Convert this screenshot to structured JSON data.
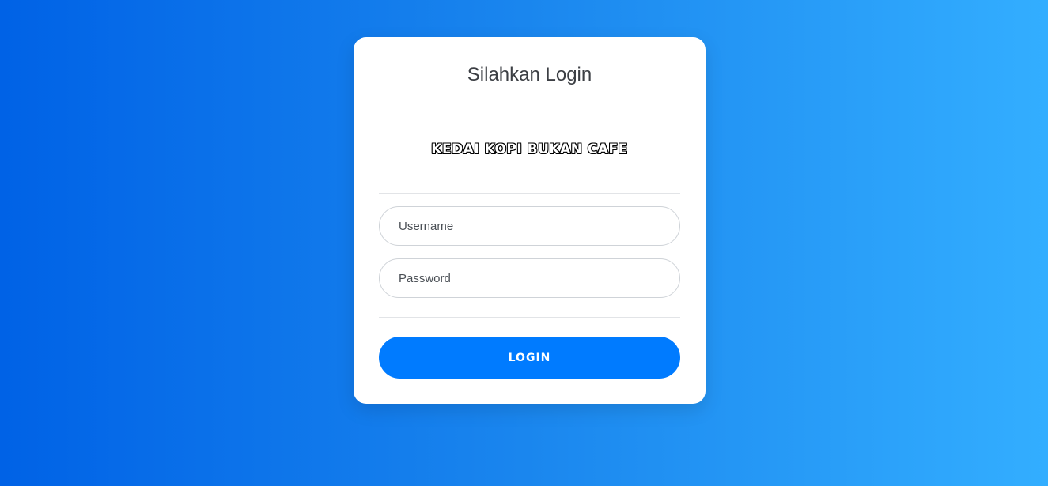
{
  "login_card": {
    "title": "Silahkan Login",
    "brand_text": "KEDAI KOPI BUKAN CAFE",
    "username": {
      "placeholder": "Username",
      "value": ""
    },
    "password": {
      "placeholder": "Password",
      "value": ""
    },
    "login_button_label": "LOGIN"
  },
  "colors": {
    "background_gradient_start": "#0062e6",
    "background_gradient_end": "#33aeff",
    "card_background": "#ffffff",
    "button_background": "#007bff",
    "button_text": "#ffffff"
  }
}
